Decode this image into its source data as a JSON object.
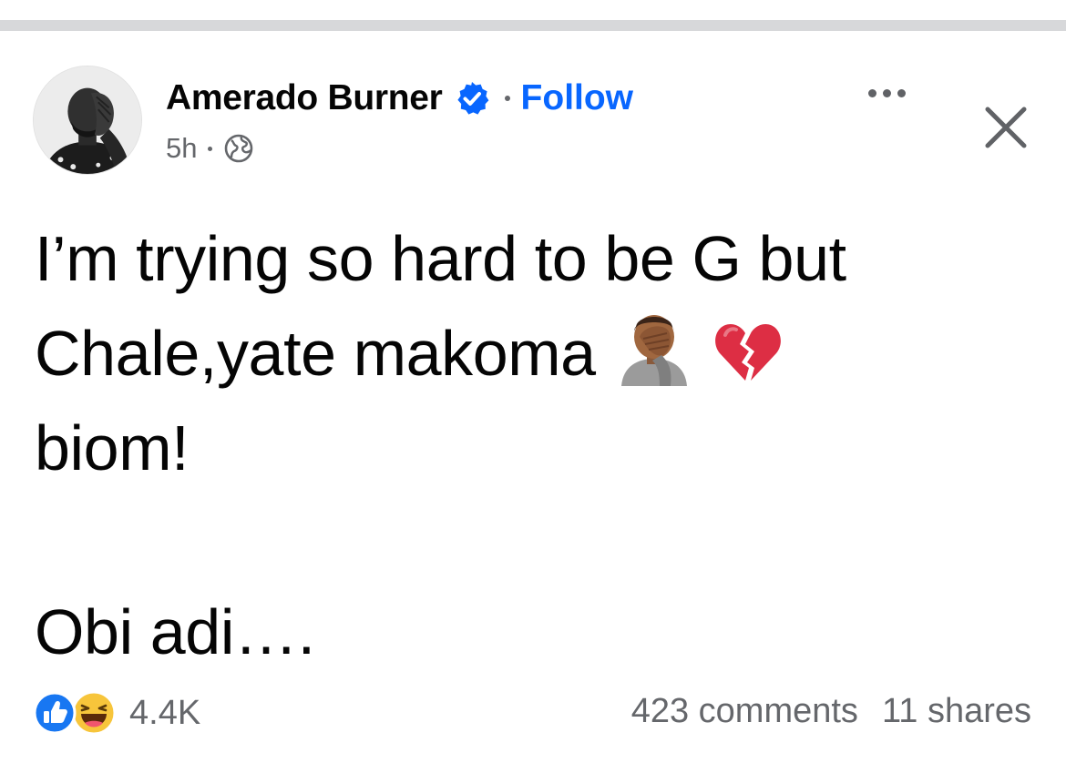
{
  "post": {
    "author": "Amerado Burner",
    "follow_label": "Follow",
    "time": "5h",
    "visibility_icon": "globe-icon",
    "text_lines": [
      "I’m trying so hard to be G but",
      "Chale,yate makoma",
      "biom!",
      "Obi adi…."
    ],
    "emojis": [
      "person-facepalming",
      "broken-heart"
    ]
  },
  "stats": {
    "reaction_icons": [
      "like-icon",
      "haha-icon"
    ],
    "reaction_count": "4.4K",
    "comments": "423 comments",
    "shares": "11 shares"
  },
  "colors": {
    "accent": "#0866ff",
    "muted_text": "#65676b",
    "divider": "#d7d8da",
    "text": "#050505"
  }
}
